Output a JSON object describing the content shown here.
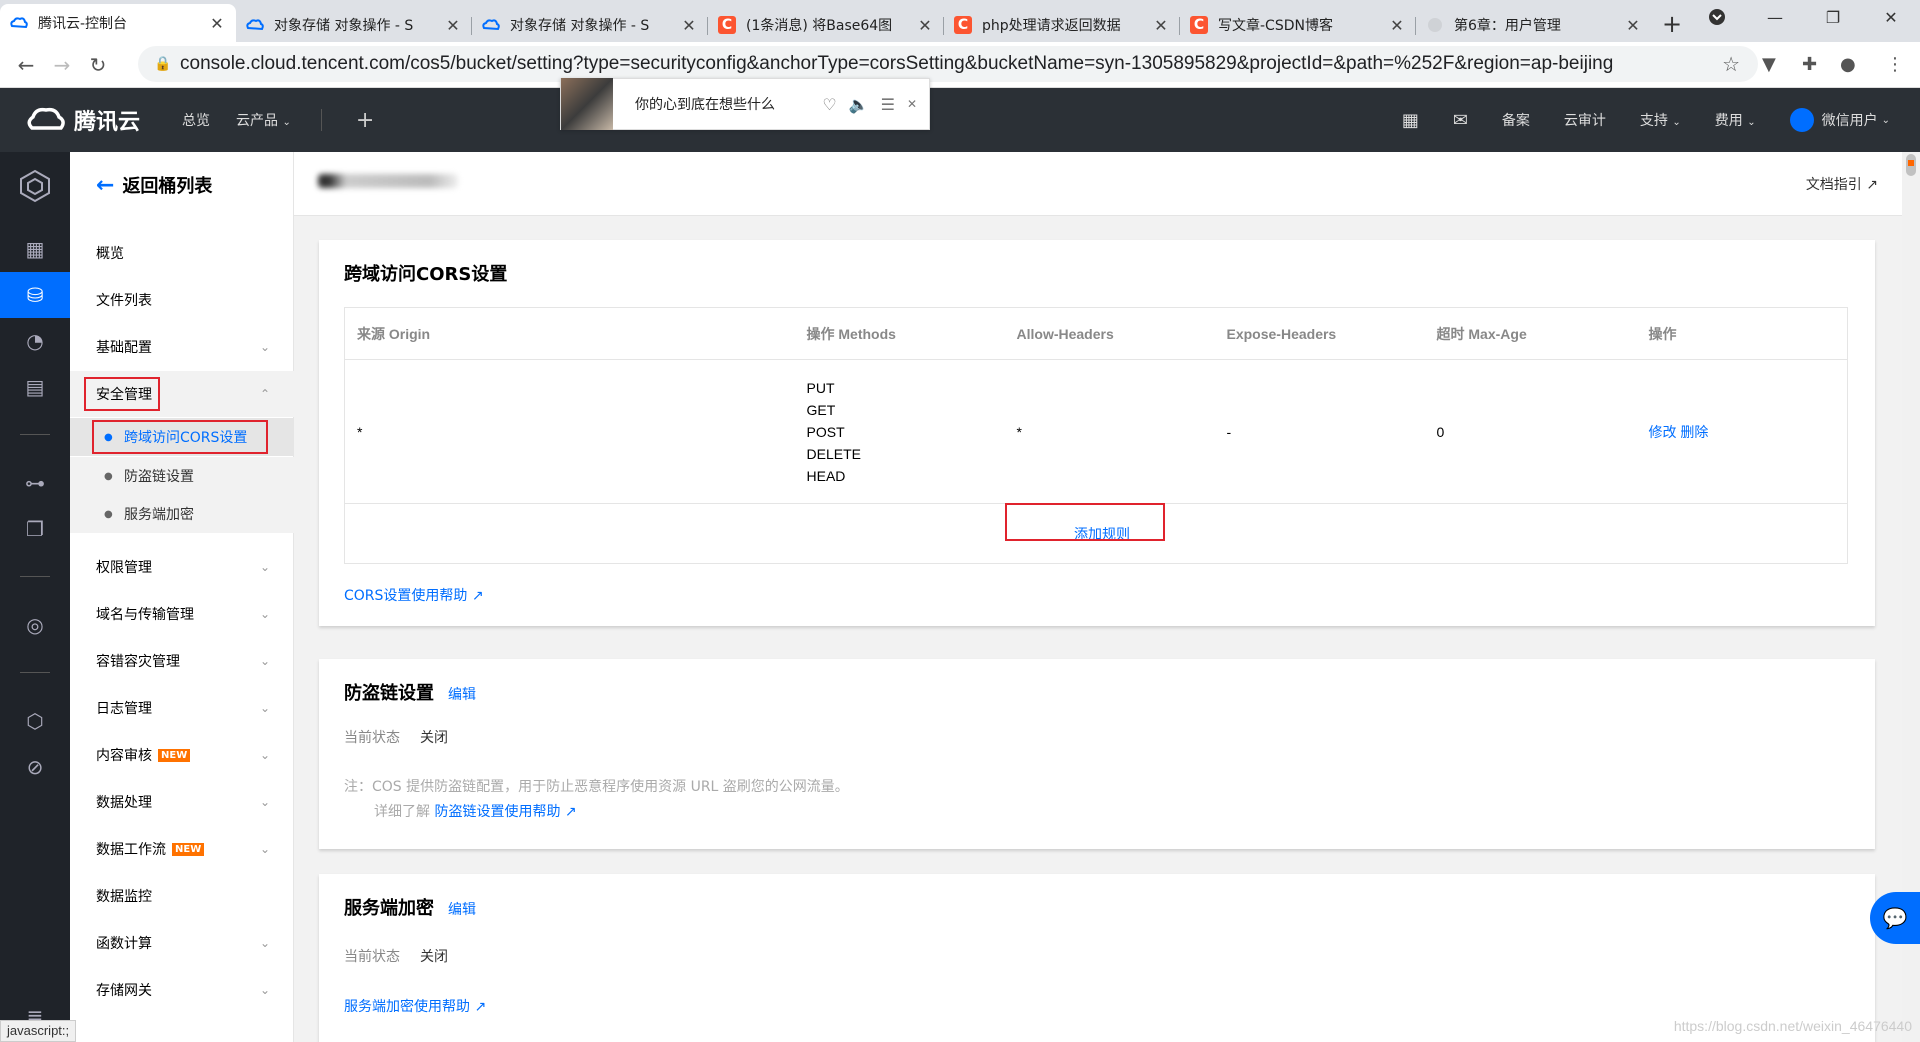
{
  "browser": {
    "tabs": [
      {
        "title": "腾讯云-控制台",
        "icon": "tencent-cloud-icon",
        "active": true
      },
      {
        "title": "对象存储 对象操作 - S",
        "icon": "tencent-cloud-icon"
      },
      {
        "title": "对象存储 对象操作 - S",
        "icon": "tencent-cloud-icon"
      },
      {
        "title": "(1条消息) 将Base64图",
        "icon": "csdn-icon"
      },
      {
        "title": "php处理请求返回数据",
        "icon": "csdn-icon"
      },
      {
        "title": "写文章-CSDN博客",
        "icon": "csdn-icon"
      },
      {
        "title": "第6章：用户管理",
        "icon": "globe-icon"
      }
    ],
    "csdn_letter": "C",
    "url": "console.cloud.tencent.com/cos5/bucket/setting?type=securityconfig&anchorType=corsSetting&bucketName=syn-1305895829&projectId=&path=%252F&region=ap-beijing",
    "status_bar": "javascript:;"
  },
  "appbar": {
    "brand": "腾讯云",
    "nav": [
      "总览",
      "云产品"
    ],
    "right": [
      "备案",
      "云审计",
      "支持",
      "费用",
      "微信用户"
    ]
  },
  "popup": {
    "text": "你的心到底在想些什么"
  },
  "sidebar": {
    "back": "返回桶列表",
    "items": [
      {
        "label": "概览"
      },
      {
        "label": "文件列表"
      },
      {
        "label": "基础配置"
      },
      {
        "label": "安全管理"
      },
      {
        "label": "权限管理"
      },
      {
        "label": "域名与传输管理"
      },
      {
        "label": "容错容灾管理"
      },
      {
        "label": "日志管理"
      },
      {
        "label": "内容审核"
      },
      {
        "label": "数据处理"
      },
      {
        "label": "数据工作流"
      },
      {
        "label": "数据监控"
      },
      {
        "label": "函数计算"
      },
      {
        "label": "存储网关"
      }
    ],
    "sub_items": [
      "跨域访问CORS设置",
      "防盗链设置",
      "服务端加密"
    ],
    "new_badge": "NEW"
  },
  "main": {
    "doc_guide": "文档指引",
    "cors": {
      "title": "跨域访问CORS设置",
      "columns": [
        "来源 Origin",
        "操作 Methods",
        "Allow-Headers",
        "Expose-Headers",
        "超时 Max-Age",
        "操作"
      ],
      "row": {
        "origin": "*",
        "methods": [
          "PUT",
          "GET",
          "POST",
          "DELETE",
          "HEAD"
        ],
        "allow_headers": "*",
        "expose_headers": "-",
        "max_age": "0",
        "edit": "修改",
        "delete": "删除"
      },
      "add_rule": "添加规则",
      "help": "CORS设置使用帮助"
    },
    "hotlink": {
      "title": "防盗链设置",
      "edit": "编辑",
      "status_label": "当前状态",
      "status_value": "关闭",
      "note_line1": "注：COS 提供防盗链配置，用于防止恶意程序使用资源 URL 盗刷您的公网流量。",
      "note_prefix": "详细了解",
      "note_link": "防盗链设置使用帮助"
    },
    "encryption": {
      "title": "服务端加密",
      "edit": "编辑",
      "status_label": "当前状态",
      "status_value": "关闭",
      "help": "服务端加密使用帮助"
    }
  },
  "watermark": "https://blog.csdn.net/weixin_46476440",
  "colors": {
    "accent": "#006eff",
    "highlight": "#e0232d",
    "appbar": "#2b3036",
    "rail": "#1f2329"
  }
}
